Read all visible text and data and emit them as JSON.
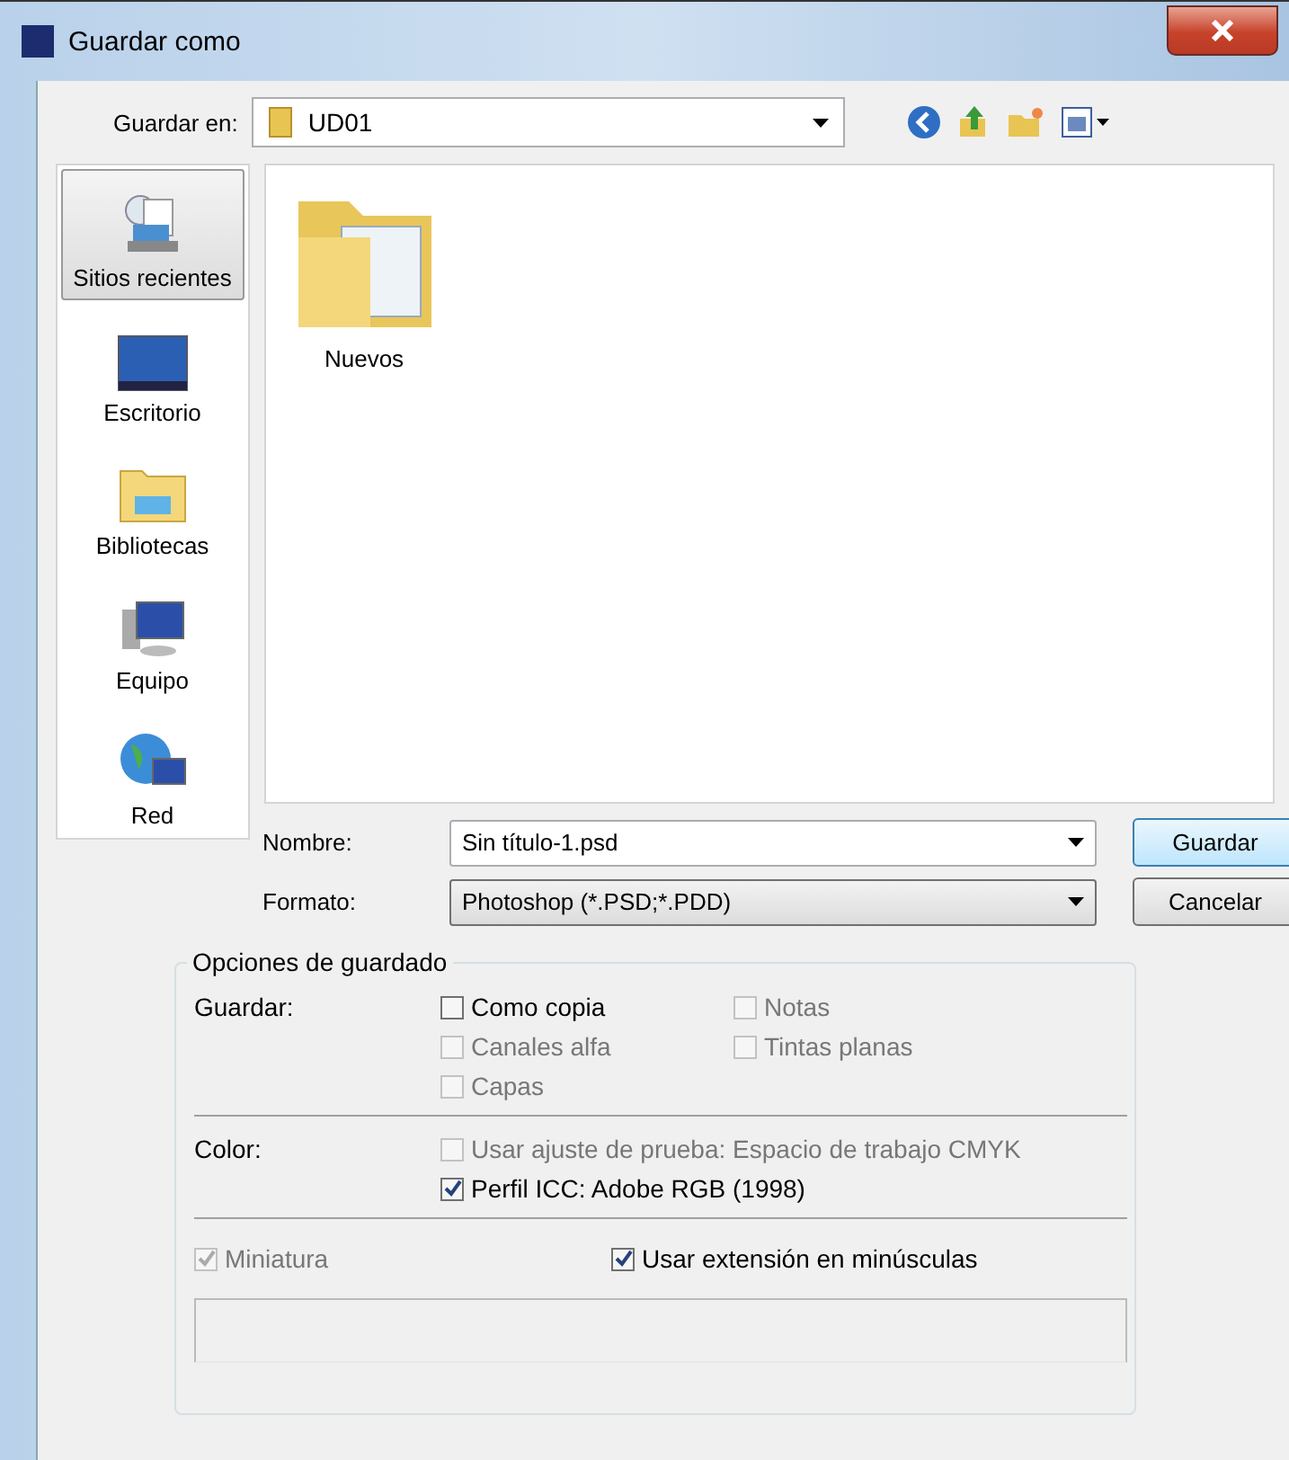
{
  "window": {
    "title": "Guardar como"
  },
  "save_in": {
    "label": "Guardar en:",
    "value": "UD01"
  },
  "places": [
    {
      "label": "Sitios recientes",
      "kind": "recent",
      "selected": true
    },
    {
      "label": "Escritorio",
      "kind": "desktop",
      "selected": false
    },
    {
      "label": "Bibliotecas",
      "kind": "libraries",
      "selected": false
    },
    {
      "label": "Equipo",
      "kind": "computer",
      "selected": false
    },
    {
      "label": "Red",
      "kind": "network",
      "selected": false
    }
  ],
  "files": [
    {
      "name": "Nuevos"
    }
  ],
  "name_field": {
    "label": "Nombre:",
    "value": "Sin título-1.psd"
  },
  "format_field": {
    "label": "Formato:",
    "value": "Photoshop (*.PSD;*.PDD)"
  },
  "buttons": [
    {
      "label": "Guardar",
      "default": true
    },
    {
      "label": "Cancelar",
      "default": false
    }
  ],
  "options": {
    "title": "Opciones de guardado",
    "save_label": "Guardar:",
    "save_checks": [
      {
        "label": "Como copia",
        "checked": false,
        "disabled": false
      },
      {
        "label": "Notas",
        "checked": false,
        "disabled": true
      },
      {
        "label": "Canales alfa",
        "checked": false,
        "disabled": true
      },
      {
        "label": "Tintas planas",
        "checked": false,
        "disabled": true
      },
      {
        "label": "Capas",
        "checked": false,
        "disabled": true
      }
    ],
    "color_label": "Color:",
    "color_checks": [
      {
        "label": "Usar ajuste de prueba: Espacio de trabajo CMYK",
        "checked": false,
        "disabled": true
      },
      {
        "label": "Perfil ICC: Adobe RGB (1998)",
        "checked": true,
        "disabled": false
      }
    ],
    "bottom_checks": [
      {
        "label": "Miniatura",
        "checked": true,
        "disabled": true
      },
      {
        "label": "Usar extensión en minúsculas",
        "checked": true,
        "disabled": false
      }
    ]
  }
}
